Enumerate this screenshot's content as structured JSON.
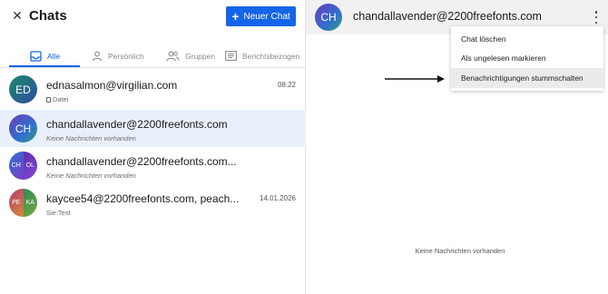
{
  "left_panel": {
    "title": "Chats",
    "new_chat_label": "Neuer Chat",
    "tabs": [
      {
        "label": "Alle",
        "icon": "inbox-icon",
        "active": true
      },
      {
        "label": "Persönlich",
        "icon": "person-icon",
        "active": false
      },
      {
        "label": "Gruppen",
        "icon": "group-icon",
        "active": false
      },
      {
        "label": "Berichtsbezogen",
        "icon": "report-icon",
        "active": false
      }
    ],
    "chats": [
      {
        "name": "ednasalmon@virgilian.com",
        "subtitle": "Datei",
        "time": "08:22",
        "avatar": "ED"
      },
      {
        "name": "chandallavender@2200freefonts.com",
        "subtitle": "Keine Nachrichten vorhanden",
        "time": "",
        "avatar": "CH"
      },
      {
        "name": "chandallavender@2200freefonts.com...",
        "subtitle": "Keine Nachrichten vorhanden",
        "time": "",
        "avatar": [
          "CH",
          "OL"
        ]
      },
      {
        "name": "kaycee54@2200freefonts.com, peach...",
        "subtitle": "Sie:Test",
        "time": "14.01.2026",
        "avatar": [
          "PE",
          "KA"
        ]
      }
    ]
  },
  "right_panel": {
    "avatar": "CH",
    "title": "chandallavender@2200freefonts.com",
    "menu": [
      {
        "label": "Chat löschen"
      },
      {
        "label": "Als ungelesen markieren"
      },
      {
        "label": "Benachrichtigungen stummschalten"
      }
    ],
    "empty_text": "Keine Nachrichten vorhanden"
  },
  "colors": {
    "accent": "#1565e8",
    "selected_row": "#eaf0fb",
    "header_bg": "#f1f1f1"
  }
}
